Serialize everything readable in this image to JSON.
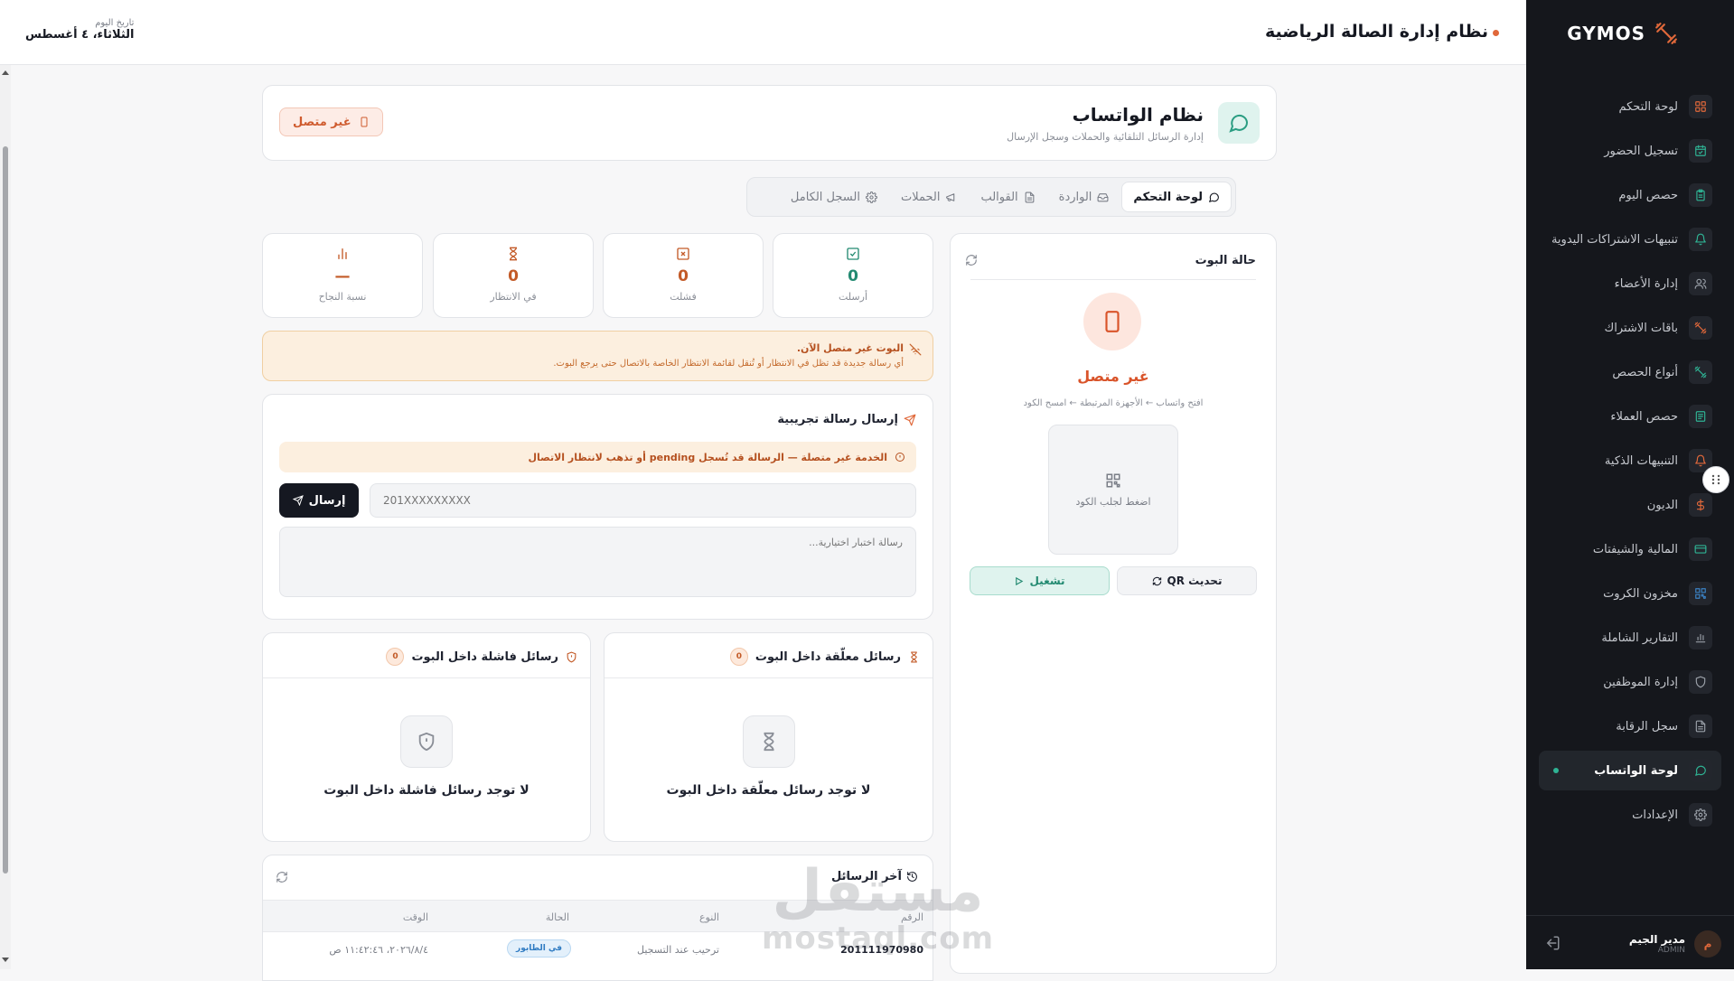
{
  "sidebar": {
    "brand": "GYMOS",
    "items": [
      {
        "label": "لوحة التحكم",
        "icon": "grid-icon",
        "color": "#e0683a"
      },
      {
        "label": "تسجيل الحضور",
        "icon": "calendar-check-icon",
        "color": "#2fb394"
      },
      {
        "label": "حصص اليوم",
        "icon": "clipboard-icon",
        "color": "#2fb394"
      },
      {
        "label": "تنبيهات الاشتراكات اليدوية",
        "icon": "bell-icon",
        "color": "#2fb394"
      },
      {
        "label": "إدارة الأعضاء",
        "icon": "users-icon",
        "color": "#9aa0a8"
      },
      {
        "label": "باقات الاشتراك",
        "icon": "dumbbell-icon",
        "color": "#e0683a"
      },
      {
        "label": "أنواع الحصص",
        "icon": "dumbbell-icon",
        "color": "#2fb394"
      },
      {
        "label": "حصص العملاء",
        "icon": "list-icon",
        "color": "#2fb394"
      },
      {
        "label": "التنبيهات الذكية",
        "icon": "bell-icon",
        "color": "#e0683a"
      },
      {
        "label": "الديون",
        "icon": "dollar-icon",
        "color": "#e0683a"
      },
      {
        "label": "المالية والشيفتات",
        "icon": "card-icon",
        "color": "#2fb394"
      },
      {
        "label": "مخزون الكروت",
        "icon": "qr-icon",
        "color": "#3b82c4"
      },
      {
        "label": "التقارير الشاملة",
        "icon": "bar-chart-icon",
        "color": "#9aa0a8"
      },
      {
        "label": "إدارة الموظفين",
        "icon": "shield-icon",
        "color": "#9aa0a8"
      },
      {
        "label": "سجل الرقابة",
        "icon": "file-icon",
        "color": "#9aa0a8"
      },
      {
        "label": "لوحة الواتساب",
        "icon": "chat-icon",
        "color": "#2fb394",
        "active": true
      },
      {
        "label": "الإعدادات",
        "icon": "gear-icon",
        "color": "#9aa0a8"
      }
    ],
    "user": {
      "name": "مدير الجيم",
      "role": "ADMIN",
      "initial": "م"
    }
  },
  "header": {
    "title": "نظام إدارة الصالة الرياضية",
    "date_label": "تاريخ اليوم",
    "date_value": "الثلاثاء، ٤ أغسطس"
  },
  "page": {
    "title": "نظام الواتساب",
    "subtitle": "إدارة الرسائل التلقائية والحملات وسجل الإرسال",
    "status_badge": "غير متصل"
  },
  "tabs": [
    {
      "label": "لوحة التحكم",
      "icon": "chat-icon",
      "active": true
    },
    {
      "label": "الواردة",
      "icon": "inbox-icon"
    },
    {
      "label": "القوالب",
      "icon": "file-icon"
    },
    {
      "label": "الحملات",
      "icon": "megaphone-icon"
    },
    {
      "label": "السجل الكامل",
      "icon": "gear-icon"
    }
  ],
  "bot": {
    "title": "حالة البوت",
    "status": "غير متصل",
    "hint": "افتح واتساب ← الأجهزة المرتبطة ← امسح الكود",
    "qr_text": "اضغط لجلب الكود",
    "run_button": "تشغيل",
    "refresh_qr_button": "تحديث QR"
  },
  "stats": [
    {
      "label": "أرسلت",
      "value": "0",
      "color": "#238a71",
      "icon": "check-square-icon"
    },
    {
      "label": "فشلت",
      "value": "0",
      "color": "#c35a27",
      "icon": "x-square-icon"
    },
    {
      "label": "في الانتظار",
      "value": "0",
      "color": "#c35a27",
      "icon": "hourglass-icon"
    },
    {
      "label": "نسبة النجاح",
      "value": "—",
      "color": "#c35a27",
      "icon": "bar-chart-icon"
    }
  ],
  "warning": {
    "title": "البوت غير متصل الآن.",
    "text": "أي رسالة جديدة قد تظل في الانتظار أو تُنقل لقائمة الانتظار الخاصة بالاتصال حتى يرجع البوت."
  },
  "test_message": {
    "title": "إرسال رسالة تجريبية",
    "notice": "الخدمة غير متصلة — الرسالة قد تُسجل pending أو تذهب لانتظار الاتصال",
    "send_button": "إرسال",
    "phone_placeholder": "201XXXXXXXXX",
    "message_placeholder": "رسالة اختبار اختيارية..."
  },
  "stuck": {
    "title": "رسائل معلّقة داخل البوت",
    "count": "0",
    "empty": "لا توجد رسائل معلّقة داخل البوت"
  },
  "failed": {
    "title": "رسائل فاشلة داخل البوت",
    "count": "0",
    "empty": "لا توجد رسائل فاشلة داخل البوت"
  },
  "latest": {
    "title": "آخر الرسائل",
    "columns": [
      "الرقم",
      "النوع",
      "الحالة",
      "الوقت"
    ],
    "rows": [
      {
        "number": "201111970980",
        "type": "ترحيب عند التسجيل",
        "status": "في الطابور",
        "time": "٢٠٢٦/٨/٤، ١١:٤٢:٤٦ ص"
      }
    ]
  },
  "watermark": {
    "arabic": "مستقل",
    "latin": "mostaql.com"
  }
}
